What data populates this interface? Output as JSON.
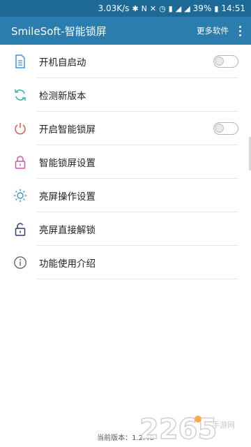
{
  "status_bar": {
    "network_speed": "3.03K/s",
    "battery": "39%",
    "time": "14:51"
  },
  "app_bar": {
    "title": "SmileSoft-智能锁屏",
    "more_software": "更多软件"
  },
  "menu_items": [
    {
      "label": "开机自启动",
      "icon": "document-icon",
      "icon_color": "#4a90d9",
      "toggle": false
    },
    {
      "label": "检测新版本",
      "icon": "refresh-icon",
      "icon_color": "#2cb5a5"
    },
    {
      "label": "开启智能锁屏",
      "icon": "power-icon",
      "icon_color": "#e05a4f",
      "toggle": false
    },
    {
      "label": "智能锁屏设置",
      "icon": "lock-icon",
      "icon_color": "#c45aa8"
    },
    {
      "label": "亮屏操作设置",
      "icon": "sun-icon",
      "icon_color": "#3a8fd6"
    },
    {
      "label": "亮屏直接解锁",
      "icon": "unlock-icon",
      "icon_color": "#2d3f6e"
    },
    {
      "label": "功能使用介绍",
      "icon": "info-icon",
      "icon_color": "#666666"
    }
  ],
  "footer": {
    "version_text": "当前版本：1.2.48"
  },
  "watermark": {
    "number": "2265",
    "suffix": "手游网"
  },
  "colors": {
    "status_bar": "#1e6a97",
    "app_bar": "#2b7dad"
  }
}
